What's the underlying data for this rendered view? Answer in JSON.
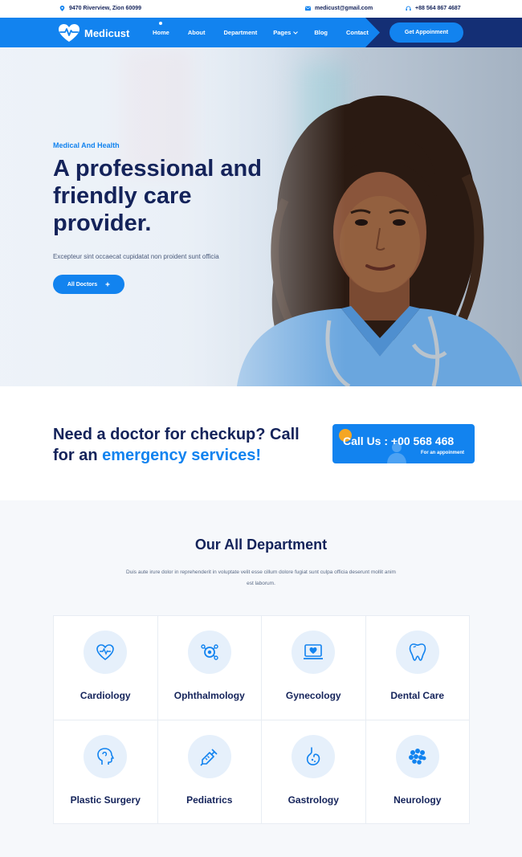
{
  "topbar": {
    "address": "9470 Riverview, Zion 60099",
    "email": "medicust@gmail.com",
    "phone": "+88 564 867 4687"
  },
  "nav": {
    "brand": "Medicust",
    "items": [
      {
        "label": "Home",
        "active": true
      },
      {
        "label": "About"
      },
      {
        "label": "Department"
      },
      {
        "label": "Pages",
        "dropdown": true
      },
      {
        "label": "Blog"
      },
      {
        "label": "Contact"
      }
    ],
    "cta": "Get Appoinment"
  },
  "hero": {
    "subtitle": "Medical And Health",
    "title": "A professional and friendly care provider.",
    "description": "Excepteur sint occaecat cupidatat non proident sunt officia",
    "button": "All Doctors"
  },
  "help": {
    "heading_main": "Need a doctor for checkup? Call for an ",
    "heading_accent": "emergency services!",
    "call_label": "Call Us : +00 568 468",
    "call_sub": "For an appoinment"
  },
  "departments": {
    "title": "Our All Department",
    "lead": "Duis aute irure dolor in reprehenderit in voluptate velit esse cillum dolore fugiat sunt culpa officia deserunt mollit anim est laborum.",
    "items": [
      {
        "name": "Cardiology",
        "icon": "heart-icon"
      },
      {
        "name": "Ophthalmology",
        "icon": "eye-icon"
      },
      {
        "name": "Gynecology",
        "icon": "monitor-heart-icon"
      },
      {
        "name": "Dental Care",
        "icon": "tooth-icon"
      },
      {
        "name": "Plastic Surgery",
        "icon": "head-icon"
      },
      {
        "name": "Pediatrics",
        "icon": "syringe-icon"
      },
      {
        "name": "Gastrology",
        "icon": "stomach-icon"
      },
      {
        "name": "Neurology",
        "icon": "neuron-icon"
      }
    ]
  },
  "colors": {
    "primary": "#1283ef",
    "navy": "#14235a",
    "accent_orange": "#f5a623"
  }
}
